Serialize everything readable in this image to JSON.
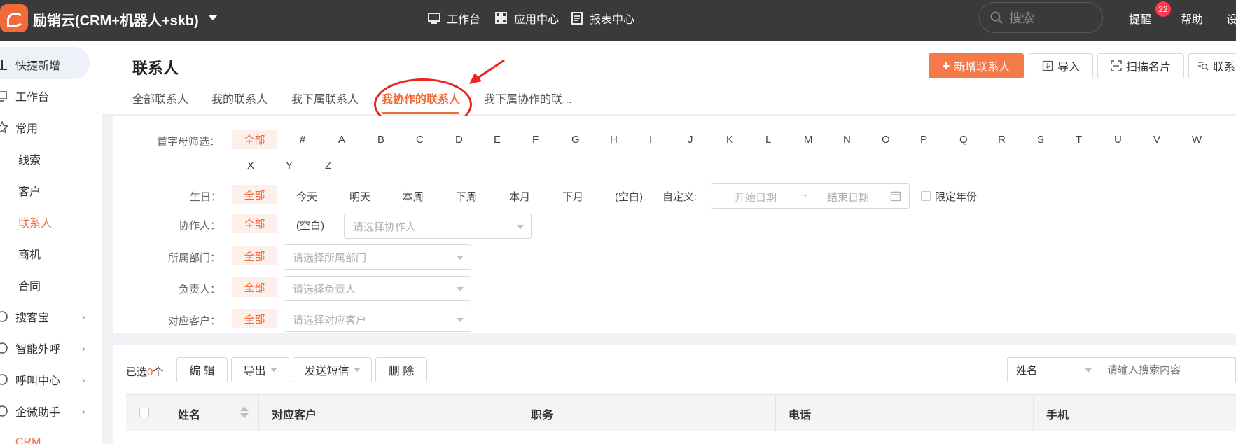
{
  "app": {
    "title": "励销云(CRM+机器人+skb)"
  },
  "topnav": {
    "items": [
      {
        "label": "工作台",
        "icon": "monitor-icon"
      },
      {
        "label": "应用中心",
        "icon": "grid-icon"
      },
      {
        "label": "报表中心",
        "icon": "report-icon"
      }
    ],
    "search_placeholder": "搜索",
    "remind_label": "提醒",
    "remind_count": "22",
    "help_label": "帮助",
    "settings_label": "设"
  },
  "sidebar": {
    "quick_add": "快捷新增",
    "items": [
      {
        "label": "工作台"
      },
      {
        "label": "常用"
      },
      {
        "label": "线索"
      },
      {
        "label": "客户"
      },
      {
        "label": "联系人",
        "active": true
      },
      {
        "label": "商机"
      },
      {
        "label": "合同"
      },
      {
        "label": "搜客宝"
      },
      {
        "label": "智能外呼"
      },
      {
        "label": "呼叫中心"
      },
      {
        "label": "企微助手"
      },
      {
        "label": "CRM"
      }
    ],
    "chevron": "›"
  },
  "header": {
    "title": "联系人",
    "tabs": [
      "全部联系人",
      "我的联系人",
      "我下属联系人",
      "我协作的联系人",
      "我下属协作的联..."
    ],
    "active_tab": 3,
    "buttons": {
      "new": "新增联系人",
      "new_plus": "+",
      "import": "导入",
      "scan": "扫描名片",
      "more": "联系"
    }
  },
  "filters": {
    "letter_label": "首字母筛选：",
    "all": "全部",
    "letters": [
      "#",
      "A",
      "B",
      "C",
      "D",
      "E",
      "F",
      "G",
      "H",
      "I",
      "J",
      "K",
      "L",
      "M",
      "N",
      "O",
      "P",
      "Q",
      "R",
      "S",
      "T",
      "U",
      "V",
      "W",
      "X",
      "Y",
      "Z"
    ],
    "birthday_label": "生日：",
    "birthday_opts": [
      "今天",
      "明天",
      "本周",
      "下周",
      "本月",
      "下月",
      "(空白)"
    ],
    "custom_label": "自定义:",
    "start_date": "开始日期",
    "date_sep": "~",
    "end_date": "结束日期",
    "limit_year": "限定年份",
    "collab_label": "协作人：",
    "blank": "(空白)",
    "collab_placeholder": "请选择协作人",
    "dept_label": "所属部门：",
    "dept_placeholder": "请选择所属部门",
    "owner_label": "负责人：",
    "owner_placeholder": "请选择负责人",
    "customer_label": "对应客户：",
    "customer_placeholder": "请选择对应客户"
  },
  "table": {
    "selected_prefix": "已选",
    "selected_count": "0",
    "selected_suffix": "个",
    "edit": "编 辑",
    "export": "导出",
    "sms": "发送短信",
    "delete": "删 除",
    "field": "姓名",
    "search_placeholder": "请输入搜索内容",
    "columns": [
      "姓名",
      "对应客户",
      "职务",
      "电话",
      "手机"
    ]
  },
  "colors": {
    "accent": "#f26b3a",
    "topbar": "#3a3a3a",
    "annotation": "#e8261c"
  }
}
